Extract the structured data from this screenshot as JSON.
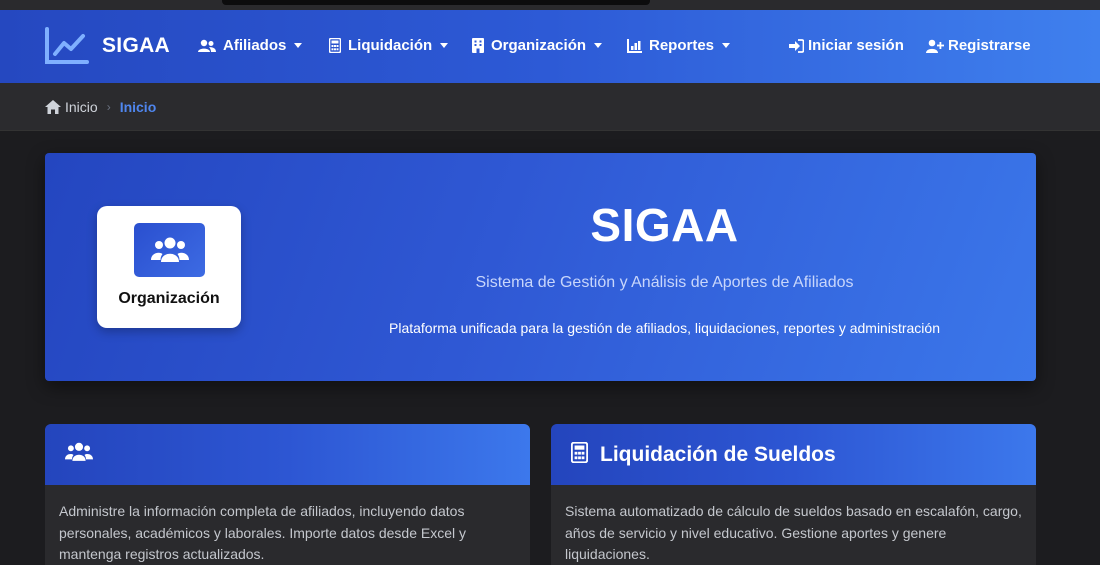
{
  "navbar": {
    "brand": "SIGAA",
    "items": [
      {
        "label": "Afiliados",
        "icon": "users-icon"
      },
      {
        "label": "Liquidación",
        "icon": "calculator-icon"
      },
      {
        "label": "Organización",
        "icon": "building-icon"
      },
      {
        "label": "Reportes",
        "icon": "chart-icon"
      }
    ],
    "login": "Iniciar sesión",
    "register": "Registrarse"
  },
  "breadcrumb": {
    "home": "Inicio",
    "current": "Inicio"
  },
  "hero": {
    "title": "SIGAA",
    "subtitle": "Sistema de Gestión y Análisis de Aportes de Afiliados",
    "description": "Plataforma unificada para la gestión de afiliados, liquidaciones, reportes y administración",
    "org_card_label": "Organización"
  },
  "cards": [
    {
      "title": "",
      "icon": "users-icon",
      "body": "Administre la información completa de afiliados, incluyendo datos personales, académicos y laborales. Importe datos desde Excel y mantenga registros actualizados."
    },
    {
      "title": "Liquidación de Sueldos",
      "icon": "calculator-icon",
      "body": "Sistema automatizado de cálculo de sueldos basado en escalafón, cargo, años de servicio y nivel educativo. Gestione aportes y genere liquidaciones."
    }
  ],
  "colors": {
    "accent": "#2d5ad6",
    "breadcrumb_current": "#4f86ee",
    "background": "#1c1c1f"
  }
}
